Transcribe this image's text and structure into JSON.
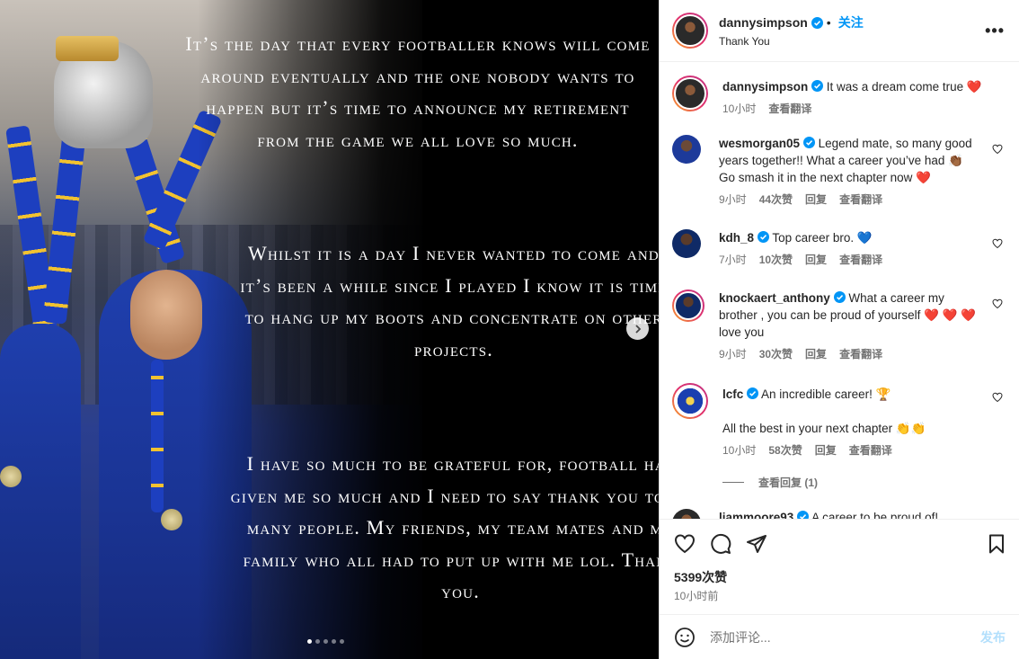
{
  "post": {
    "slide_text": [
      "It’s the day that every footballer knows will come around eventually and the one nobody wants to happen but it’s time to announce my retirement from the game we all love so much.",
      "Whilst it is a day I never wanted to come and it’s been a while since I played I know it is time to hang up my boots and concentrate on other projects.",
      "I have so much to be grateful for, football has given me so much and I need to say thank you to so many people. My friends, my team mates and my family who all had to put up with me lol. Thank you."
    ],
    "carousel": {
      "total": 5,
      "active_index": 0
    }
  },
  "header": {
    "username": "dannysimpson",
    "separator": "•",
    "follow_label": "关注",
    "subtitle": "Thank You",
    "more_label": "•••"
  },
  "caption": {
    "username": "dannysimpson",
    "text": "It was a dream come true",
    "emoji": "❤️",
    "time": "10小时",
    "translate": "查看翻译"
  },
  "comments": [
    {
      "username": "wesmorgan05",
      "text": "Legend mate, so many good years together!! What a career you’ve had 👏🏾 Go smash it in the next chapter now ❤️",
      "time": "9小时",
      "likes": "44次赞",
      "reply": "回复",
      "translate": "查看翻译"
    },
    {
      "username": "kdh_8",
      "text": "Top career bro. 💙",
      "time": "7小时",
      "likes": "10次赞",
      "reply": "回复",
      "translate": "查看翻译"
    },
    {
      "username": "knockaert_anthony",
      "text": "What a career my brother , you can be proud of yourself ❤️ ❤️ ❤️ love you",
      "time": "9小时",
      "likes": "30次赞",
      "reply": "回复",
      "translate": "查看翻译"
    },
    {
      "username": "lcfc",
      "text": "An incredible career! 🏆",
      "text2": "All the best in your next chapter 👏👏",
      "time": "10小时",
      "likes": "58次赞",
      "reply": "回复",
      "translate": "查看翻译"
    },
    {
      "username": "liammoore93",
      "text": "A career to be proud of!"
    }
  ],
  "view_replies": "查看回复 (1)",
  "stats": {
    "likes": "5399次赞",
    "posted": "10小时前"
  },
  "composer": {
    "placeholder": "添加评论...",
    "post_label": "发布"
  },
  "colors": {
    "link_blue": "#0095f6",
    "verified_blue": "#0095f6",
    "like_red": "#ed4956"
  }
}
